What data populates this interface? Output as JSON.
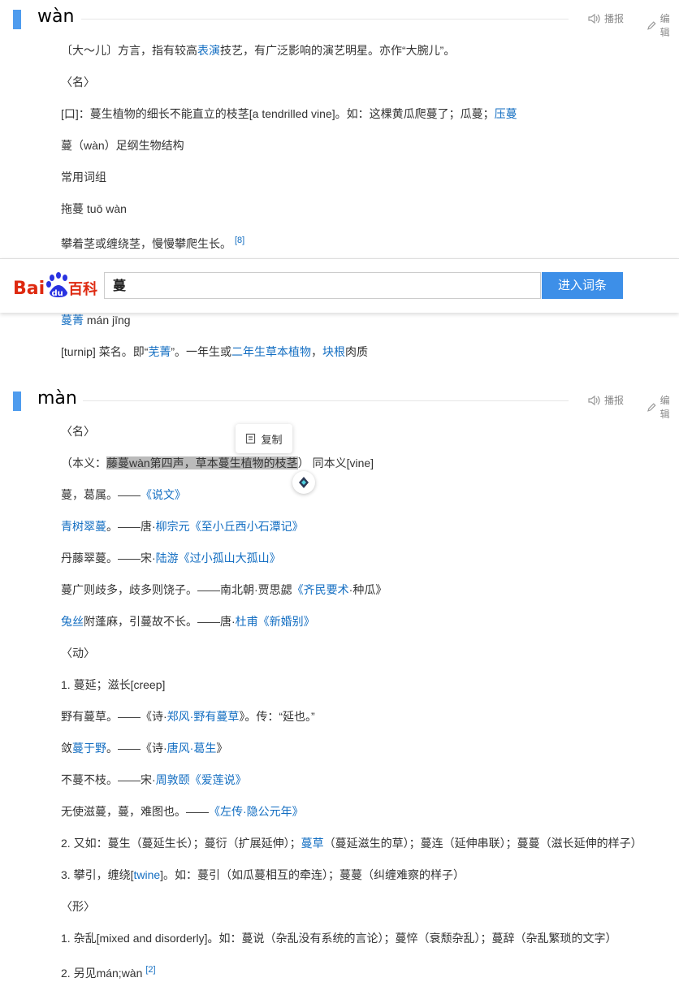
{
  "section1": {
    "pinyin": "wàn",
    "play_label": "播报",
    "edit_label": "编辑"
  },
  "s1": {
    "l1": {
      "a": "〔大～儿〕方言，指有较高",
      "b": "表演",
      "c": "技艺，有广泛影响的演艺明星。亦作“大腕儿”。"
    },
    "l2": "〈名〉",
    "l3": {
      "a": "[口]：蔓生植物的细长不能直立的枝茎[a tendrilled vine]。如：这棵黄瓜爬蔓了；瓜蔓；",
      "b": "压蔓"
    },
    "l4": "蔓（wàn）足纲生物结构",
    "l5": "常用词组",
    "l6": "拖蔓 tuō wàn",
    "l7": {
      "a": "攀着茎或缠绕茎，慢慢攀爬生长。",
      "ref": "[8]"
    },
    "l8": {
      "a": "蔓菁",
      "b": " mán jīng"
    },
    "l9": {
      "a": "[turnip] 菜名。即“",
      "b": "芜菁",
      "c": "”。一年生或",
      "d": "二年生草本植物",
      "e": "，",
      "f": "块根",
      "g": "肉质"
    }
  },
  "search": {
    "logo_text_a": "Bai",
    "logo_text_b": "du",
    "logo_text_c": "百科",
    "query": "蔓",
    "button": "进入词条"
  },
  "section2": {
    "pinyin": "màn",
    "play_label": "播报",
    "edit_label": "编辑"
  },
  "popup": {
    "copy_label": "复制"
  },
  "s2": {
    "l1": "〈名〉",
    "l2": {
      "a": "（本义：",
      "b": "藤蔓wàn第四声，草本蔓生植物的枝茎",
      "c": "）  同本义[vine]"
    },
    "l3": {
      "a": "蔓，葛属。——",
      "b": "《说文》"
    },
    "l4": {
      "a": "青树翠蔓",
      "b": "。——唐·",
      "c": "柳宗元",
      "d": "《至小丘西小石潭记》"
    },
    "l5": {
      "a": "丹藤翠蔓。——宋·",
      "b": "陆游",
      "c": "《过小孤山大孤山》"
    },
    "l6": {
      "a": "蔓广则歧多，歧多则饶子。——南北朝·贾思勰",
      "b": "《齐民要术",
      "c": "·种瓜》"
    },
    "l7": {
      "a": "兔丝",
      "b": "附蓬麻，引蔓故不长。——唐·",
      "c": "杜甫",
      "d": "《新婚别》"
    },
    "l8": "〈动〉",
    "l9": "1. 蔓延；滋长[creep]",
    "l10": {
      "a": "野有蔓草。——《诗·",
      "b": "郑风·野有蔓草",
      "c": "》。传：“延也。”"
    },
    "l11": {
      "a": "敛",
      "b": "蔓于野",
      "c": "。——《诗·",
      "d": "唐风·葛生",
      "e": "》"
    },
    "l12": {
      "a": "不蔓不枝。——宋·",
      "b": "周敦颐",
      "c": "《爱莲说》"
    },
    "l13": {
      "a": "无使滋蔓，蔓，难图也。——",
      "b": "《左传·隐公元年》"
    },
    "l14": {
      "a": "2. 又如：蔓生（蔓延生长）；蔓衍（扩展延伸）；",
      "b": "蔓草",
      "c": "（蔓延滋生的草）；蔓连（延伸串联）；蔓蔓（滋长延伸的样子）"
    },
    "l15": {
      "a": "3. 攀引，缠绕[",
      "b": "twine",
      "c": "]。如：蔓引（如瓜蔓相互的牵连）；蔓蔓（纠缠难察的样子）"
    },
    "l16": "〈形〉",
    "l17": "1. 杂乱[mixed and disorderly]。如：蔓说（杂乱没有系统的言论）；蔓悴（衰颓杂乱）；蔓辞（杂乱繁琐的文字）",
    "l18": {
      "a": "2. 另见mán;wàn",
      "ref": "[2]"
    }
  }
}
